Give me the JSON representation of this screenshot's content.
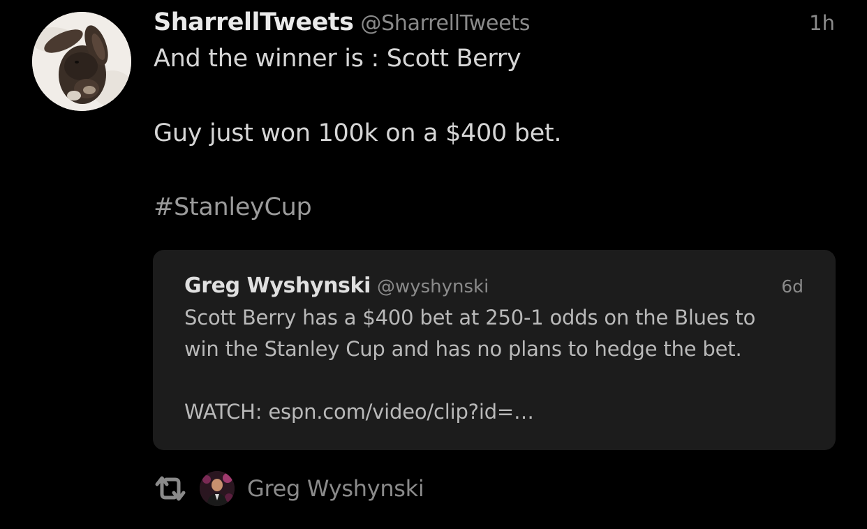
{
  "tweet": {
    "author": {
      "display_name": "SharrellTweets",
      "handle": "@SharrellTweets",
      "avatar_icon": "bunny-avatar"
    },
    "timestamp": "1h",
    "lines": [
      "And the winner is : Scott Berry",
      "Guy just won 100k on a $400 bet.",
      "#StanleyCup"
    ]
  },
  "quoted_tweet": {
    "display_name": "Greg Wyshynski",
    "handle": "@wyshynski",
    "timestamp": "6d",
    "lines": [
      "Scott Berry has a $400 bet at 250-1 odds on the Blues to",
      "win the Stanley Cup and has no plans to hedge the bet.",
      "WATCH: espn.com/video/clip?id=…"
    ]
  },
  "retweet": {
    "icon": "retweet-icon",
    "name": "Greg Wyshynski"
  },
  "colors": {
    "background": "#000000",
    "card_background": "#1c1c1c",
    "primary_text": "#eaeaea",
    "secondary_text": "#8a8a8a"
  }
}
